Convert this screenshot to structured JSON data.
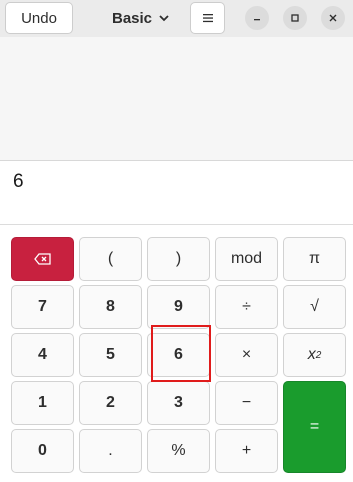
{
  "header": {
    "undo_label": "Undo",
    "mode_label": "Basic",
    "menu_icon": "hamburger-menu-icon",
    "window_controls": [
      "minimize-icon",
      "maximize-icon",
      "close-icon"
    ]
  },
  "entry": {
    "value": "6"
  },
  "keypad": {
    "row1": [
      "(",
      ")",
      "mod",
      "π"
    ],
    "row2": [
      "7",
      "8",
      "9",
      "÷",
      "√"
    ],
    "row3": [
      "4",
      "5",
      "6",
      "×",
      "x"
    ],
    "row3_superscript": "2",
    "row4": [
      "1",
      "2",
      "3",
      "−"
    ],
    "row5": [
      "0",
      ".",
      "%",
      "+"
    ],
    "equals": "=",
    "backspace_icon": "backspace-icon"
  },
  "colors": {
    "backspace": "#c8213f",
    "equals": "#1a9c2d",
    "highlight": "#e01b1b"
  }
}
